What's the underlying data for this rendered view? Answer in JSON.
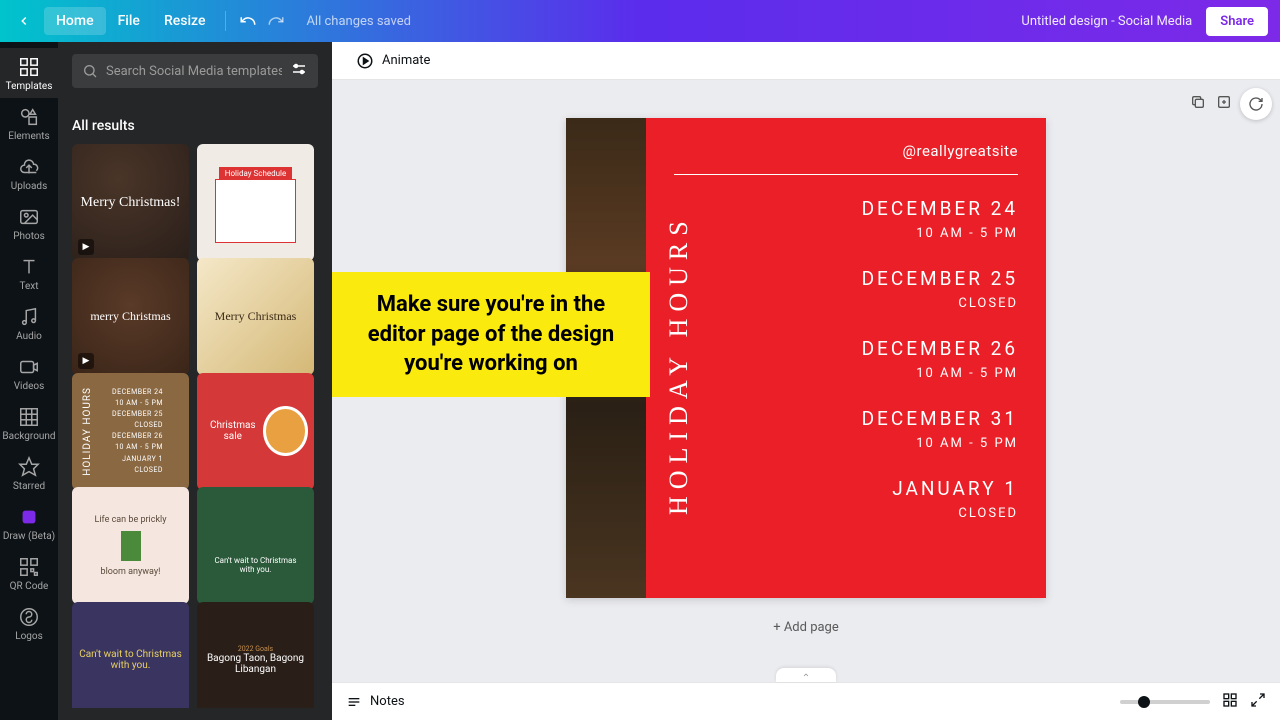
{
  "topbar": {
    "home": "Home",
    "file": "File",
    "resize": "Resize",
    "saved": "All changes saved",
    "doc_title": "Untitled design - Social Media",
    "share": "Share"
  },
  "sidebar": {
    "items": [
      {
        "id": "templates-tab",
        "label": "Templates"
      },
      {
        "id": "elements-tab",
        "label": "Elements"
      },
      {
        "id": "uploads-tab",
        "label": "Uploads"
      },
      {
        "id": "photos-tab",
        "label": "Photos"
      },
      {
        "id": "text-tab",
        "label": "Text"
      },
      {
        "id": "audio-tab",
        "label": "Audio"
      },
      {
        "id": "videos-tab",
        "label": "Videos"
      },
      {
        "id": "background-tab",
        "label": "Background"
      },
      {
        "id": "starred-tab",
        "label": "Starred"
      },
      {
        "id": "draw-tab",
        "label": "Draw (Beta)"
      },
      {
        "id": "qrcode-tab",
        "label": "QR Code"
      },
      {
        "id": "logos-tab",
        "label": "Logos"
      }
    ]
  },
  "panel": {
    "search_placeholder": "Search Social Media templates",
    "section": "All results"
  },
  "template_labels": {
    "t5_dates": "DECEMBER 24\n10 AM - 5 PM\nDECEMBER 25\nCLOSED\nDECEMBER 26\n10 AM - 5 PM\nJANUARY 1\nCLOSED",
    "t6": "Christmas sale",
    "t7a": "Life can be prickly",
    "t7b": "bloom anyway!",
    "t8": "Can't wait to Christmas with you.",
    "t9": "Can't wait to Christmas with you.",
    "t10a": "2022 Goals",
    "t10b": "Bagong Taon, Bagong Libangan"
  },
  "toolbar": {
    "animate": "Animate"
  },
  "design": {
    "handle": "@reallygreatsite",
    "vertical": "HOLIDAY HOURS",
    "entries": [
      {
        "date": "DECEMBER 24",
        "time": "10 AM - 5 PM"
      },
      {
        "date": "DECEMBER 25",
        "time": "CLOSED"
      },
      {
        "date": "DECEMBER 26",
        "time": "10 AM - 5 PM"
      },
      {
        "date": "DECEMBER 31",
        "time": "10 AM - 5 PM"
      },
      {
        "date": "JANUARY 1",
        "time": "CLOSED"
      }
    ]
  },
  "add_page": "+ Add page",
  "bottom": {
    "notes": "Notes"
  },
  "callout": "Make sure you're in the editor page of the design you're working on"
}
